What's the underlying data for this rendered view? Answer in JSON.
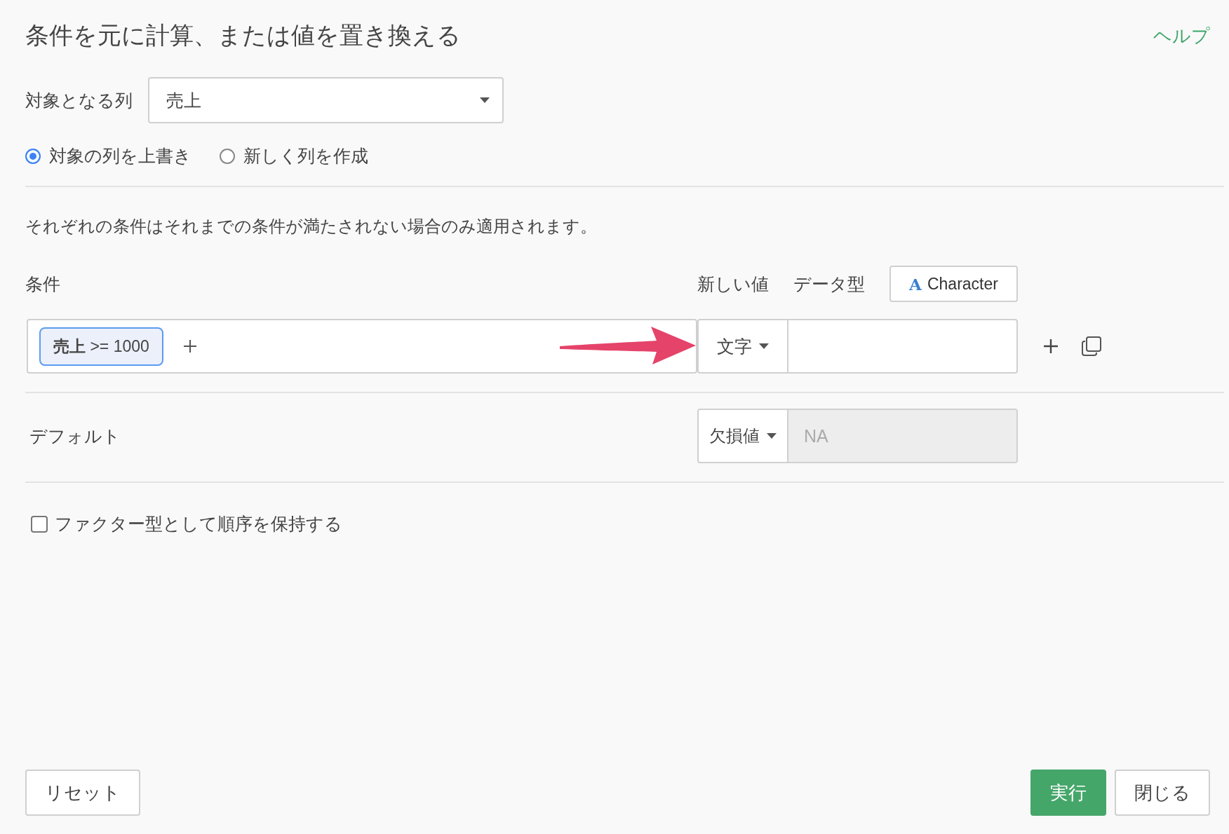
{
  "title": "条件を元に計算、または値を置き換える",
  "help_link": "ヘルプ",
  "target_column": {
    "label": "対象となる列",
    "value": "売上"
  },
  "output_mode": [
    {
      "label": "対象の列を上書き",
      "selected": true
    },
    {
      "label": "新しく列を作成",
      "selected": false
    }
  ],
  "note": "それぞれの条件はそれまでの条件が満たされない場合のみ適用されます。",
  "conditions_header": {
    "condition_label": "条件",
    "new_value_label": "新しい値",
    "data_type_label": "データ型",
    "data_type_icon": "A",
    "data_type": "Character"
  },
  "conditions": [
    {
      "expression": "**売上** >= 1000",
      "value_type": "文字"
    }
  ],
  "default": {
    "label": "デフォルト",
    "value_type": "欠損値",
    "value": "NA",
    "disabled": true
  },
  "keep_factor_order": {
    "label": "ファクター型として順序を保持する",
    "checked": false
  },
  "buttons": {
    "reset": "リセット",
    "run": "実行",
    "close": "閉じる"
  }
}
